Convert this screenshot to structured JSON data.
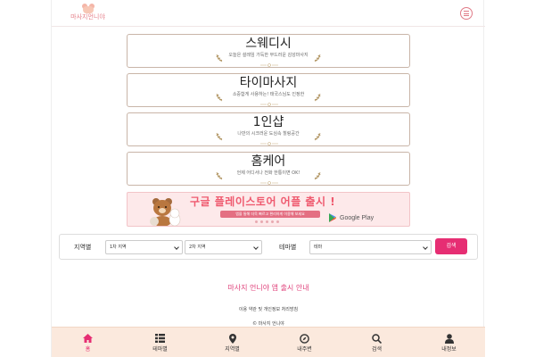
{
  "header": {
    "logo_text": "마사지언니야",
    "menu_icon": "hamburger-menu-icon"
  },
  "cards": [
    {
      "title": "스웨디시",
      "subtitle": "오늘은 설레임 가득한 부드러운 감성마사지"
    },
    {
      "title": "타이마사지",
      "subtitle": "소중함게 사용하는! 태국스님도 인정한"
    },
    {
      "title": "1인샵",
      "subtitle": "나만의 시크러운 도심속 힐링공간"
    },
    {
      "title": "홈케어",
      "subtitle": "언제 어디서나 전화 한통이면 OK!"
    }
  ],
  "banner": {
    "title": "구글 플레이스토어 어플 출시 !",
    "pill_text": "앱을 통해 더욱 빠르고 편리하게 이용해 보세요",
    "store_label": "Google Play"
  },
  "search": {
    "region_label": "지역별",
    "region1_value": "1차 지역",
    "region2_value": "2차 지역",
    "theme_label": "테마별",
    "theme_value": "테마",
    "button_label": "검색"
  },
  "notice": {
    "title": "마사지 언니야 앱 출시 안내",
    "line1": "이용 약관 및 개인정보 처리방침",
    "line2": "© 마사지 언니야"
  },
  "bottom_nav": [
    {
      "label": "홈",
      "icon": "home-icon",
      "active": true
    },
    {
      "label": "테마별",
      "icon": "list-icon",
      "active": false
    },
    {
      "label": "지역별",
      "icon": "map-pin-icon",
      "active": false
    },
    {
      "label": "내주변",
      "icon": "compass-icon",
      "active": false
    },
    {
      "label": "검색",
      "icon": "search-icon",
      "active": false
    },
    {
      "label": "내정보",
      "icon": "user-icon",
      "active": false
    }
  ],
  "colors": {
    "accent": "#e62e73",
    "nav_bg": "#fbe9dd",
    "banner_bg": "#fde9ea",
    "card_border": "#c9b5a8"
  }
}
